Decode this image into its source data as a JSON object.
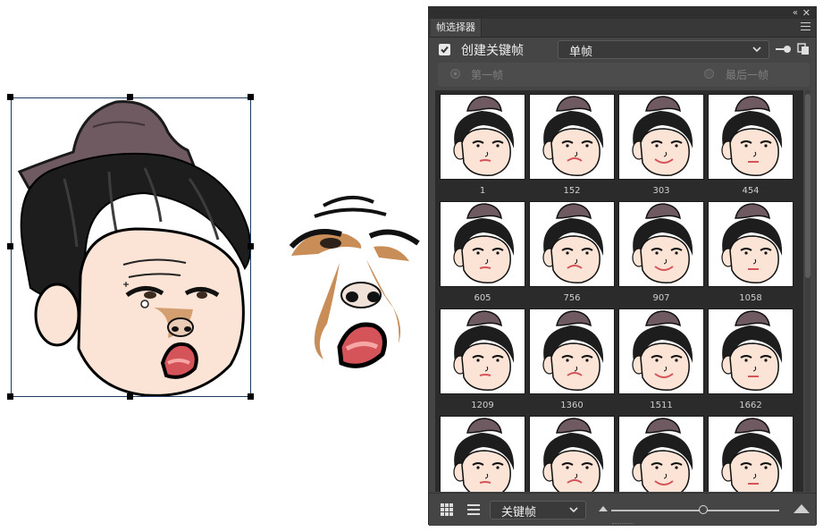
{
  "panel": {
    "tab_title": "帧选择器",
    "collapse_icon": "double-chevron-left-icon",
    "close_icon": "close-icon",
    "menu_icon": "panel-menu-icon"
  },
  "keyframe": {
    "checkbox_checked": true,
    "label": "创建关键帧",
    "mode_value": "单帧"
  },
  "range": {
    "first_label": "第一帧",
    "last_label": "最后一帧"
  },
  "frames": [
    {
      "number": "1"
    },
    {
      "number": "152"
    },
    {
      "number": "303"
    },
    {
      "number": "454"
    },
    {
      "number": "605"
    },
    {
      "number": "756"
    },
    {
      "number": "907"
    },
    {
      "number": "1058"
    },
    {
      "number": "1209"
    },
    {
      "number": "1360"
    },
    {
      "number": "1511"
    },
    {
      "number": "1662"
    },
    {
      "number": ""
    },
    {
      "number": ""
    },
    {
      "number": ""
    },
    {
      "number": ""
    }
  ],
  "bottom": {
    "filter_value": "关键帧",
    "zoom_level": 0.55
  },
  "colors": {
    "panel_bg": "#454545",
    "hat": "#6e5a60",
    "hair": "#1d1d1d",
    "skin": "#fbe4d6",
    "mouth": "#d4545a",
    "shadow": "#c98d58"
  }
}
